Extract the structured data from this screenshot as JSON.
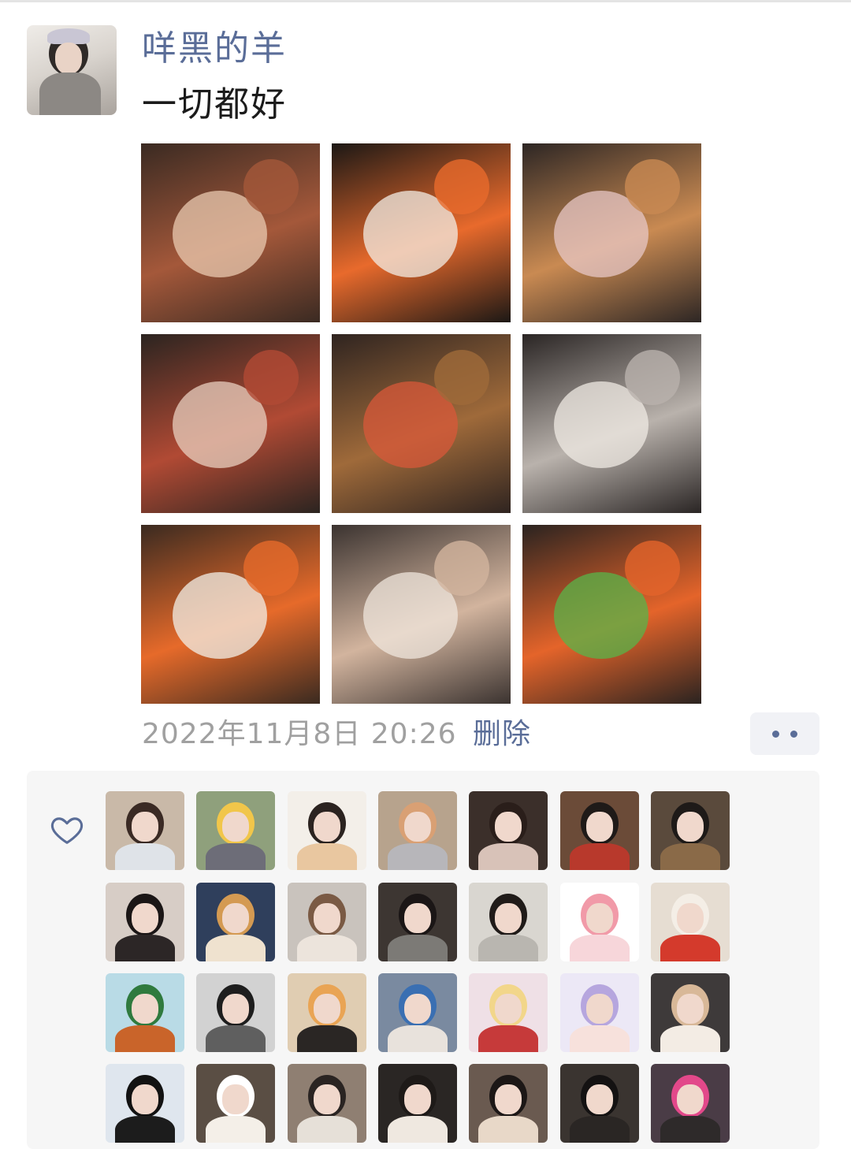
{
  "post": {
    "author": "咩黑的羊",
    "text": "一切都好",
    "timestamp": "2022年11月8日 20:26",
    "delete_label": "删除",
    "more_icon": "more-dots-icon"
  },
  "photos": [
    {
      "name": "photo-1",
      "colors": [
        "#3a2a22",
        "#a4583a",
        "#e9c9b0"
      ]
    },
    {
      "name": "photo-2",
      "colors": [
        "#1c1815",
        "#e86a2c",
        "#f2ece4"
      ]
    },
    {
      "name": "photo-3",
      "colors": [
        "#2d2624",
        "#c98a52",
        "#e7c7c6"
      ]
    },
    {
      "name": "photo-4",
      "colors": [
        "#2b2420",
        "#b14a34",
        "#e8cfbf"
      ]
    },
    {
      "name": "photo-5",
      "colors": [
        "#2f2420",
        "#9f6a3a",
        "#d8583a"
      ]
    },
    {
      "name": "photo-6",
      "colors": [
        "#2a2524",
        "#b9b2ac",
        "#efe9e3"
      ]
    },
    {
      "name": "photo-7",
      "colors": [
        "#3a2a20",
        "#e66a2a",
        "#f1efe7"
      ]
    },
    {
      "name": "photo-8",
      "colors": [
        "#3b3330",
        "#d2b49e",
        "#efe5dc"
      ]
    },
    {
      "name": "photo-9",
      "colors": [
        "#2a2320",
        "#e4642a",
        "#58b44a"
      ]
    }
  ],
  "likes": {
    "icon": "heart-outline-icon",
    "avatars": [
      {
        "name": "like-avatar-1",
        "bg": "#c9b9a8",
        "hair": "#3a2a24",
        "body": "#dfe3e8"
      },
      {
        "name": "like-avatar-2",
        "bg": "#8fa07c",
        "hair": "#f1c64a",
        "body": "#6d6d78"
      },
      {
        "name": "like-avatar-3",
        "bg": "#f3efe9",
        "hair": "#2b2320",
        "body": "#e9c7a0"
      },
      {
        "name": "like-avatar-4",
        "bg": "#b7a38d",
        "hair": "#d9a074",
        "body": "#b7b6ba"
      },
      {
        "name": "like-avatar-5",
        "bg": "#3b2f2a",
        "hair": "#2a1e1a",
        "body": "#d8c2b8"
      },
      {
        "name": "like-avatar-6",
        "bg": "#6b4b38",
        "hair": "#1f1a18",
        "body": "#b8392c"
      },
      {
        "name": "like-avatar-7",
        "bg": "#5a4a3c",
        "hair": "#1e1a18",
        "body": "#8a6a48"
      },
      {
        "name": "like-avatar-8",
        "bg": "#d7cdc6",
        "hair": "#1b1616",
        "body": "#2c2626"
      },
      {
        "name": "like-avatar-9",
        "bg": "#2f3f5c",
        "hair": "#d49a52",
        "body": "#efe2cf"
      },
      {
        "name": "like-avatar-10",
        "bg": "#c9c3bd",
        "hair": "#7a5a44",
        "body": "#ece4dc"
      },
      {
        "name": "like-avatar-11",
        "bg": "#3d3632",
        "hair": "#1b1616",
        "body": "#7c7a76"
      },
      {
        "name": "like-avatar-12",
        "bg": "#d9d6d0",
        "hair": "#201b19",
        "body": "#b9b6b0"
      },
      {
        "name": "like-avatar-13",
        "bg": "#ffffff",
        "hair": "#f19aa8",
        "body": "#f7d6da"
      },
      {
        "name": "like-avatar-14",
        "bg": "#e6ddd2",
        "hair": "#f4eee6",
        "body": "#d43a2c"
      },
      {
        "name": "like-avatar-15",
        "bg": "#b9dbe6",
        "hair": "#2f7a3e",
        "body": "#c9642a"
      },
      {
        "name": "like-avatar-16",
        "bg": "#d2d2d2",
        "hair": "#1e1e1e",
        "body": "#5f5f5f"
      },
      {
        "name": "like-avatar-17",
        "bg": "#e0cdb2",
        "hair": "#e9a454",
        "body": "#2a2624"
      },
      {
        "name": "like-avatar-18",
        "bg": "#7a8aa0",
        "hair": "#3a6fb2",
        "body": "#e8e2dc"
      },
      {
        "name": "like-avatar-19",
        "bg": "#efe0e6",
        "hair": "#f2d68a",
        "body": "#c63a3a"
      },
      {
        "name": "like-avatar-20",
        "bg": "#ece8f6",
        "hair": "#b6a6de",
        "body": "#f7e1dc"
      },
      {
        "name": "like-avatar-21",
        "bg": "#3e3a3a",
        "hair": "#d8b898",
        "body": "#f3ece4"
      },
      {
        "name": "like-avatar-22",
        "bg": "#dfe6ee",
        "hair": "#121212",
        "body": "#1c1c1c"
      },
      {
        "name": "like-avatar-23",
        "bg": "#5a4e44",
        "hair": "#ffffff",
        "body": "#f4efe8"
      },
      {
        "name": "like-avatar-24",
        "bg": "#8f7f72",
        "hair": "#2a2422",
        "body": "#e6e0d8"
      },
      {
        "name": "like-avatar-25",
        "bg": "#2a2624",
        "hair": "#1e1a18",
        "body": "#efe8e0"
      },
      {
        "name": "like-avatar-26",
        "bg": "#6a5a50",
        "hair": "#1c1716",
        "body": "#e8d8c8"
      },
      {
        "name": "like-avatar-27",
        "bg": "#3a3430",
        "hair": "#141212",
        "body": "#2a2624"
      },
      {
        "name": "like-avatar-28",
        "bg": "#4a3c46",
        "hair": "#e2488a",
        "body": "#2e2a2a"
      }
    ]
  }
}
